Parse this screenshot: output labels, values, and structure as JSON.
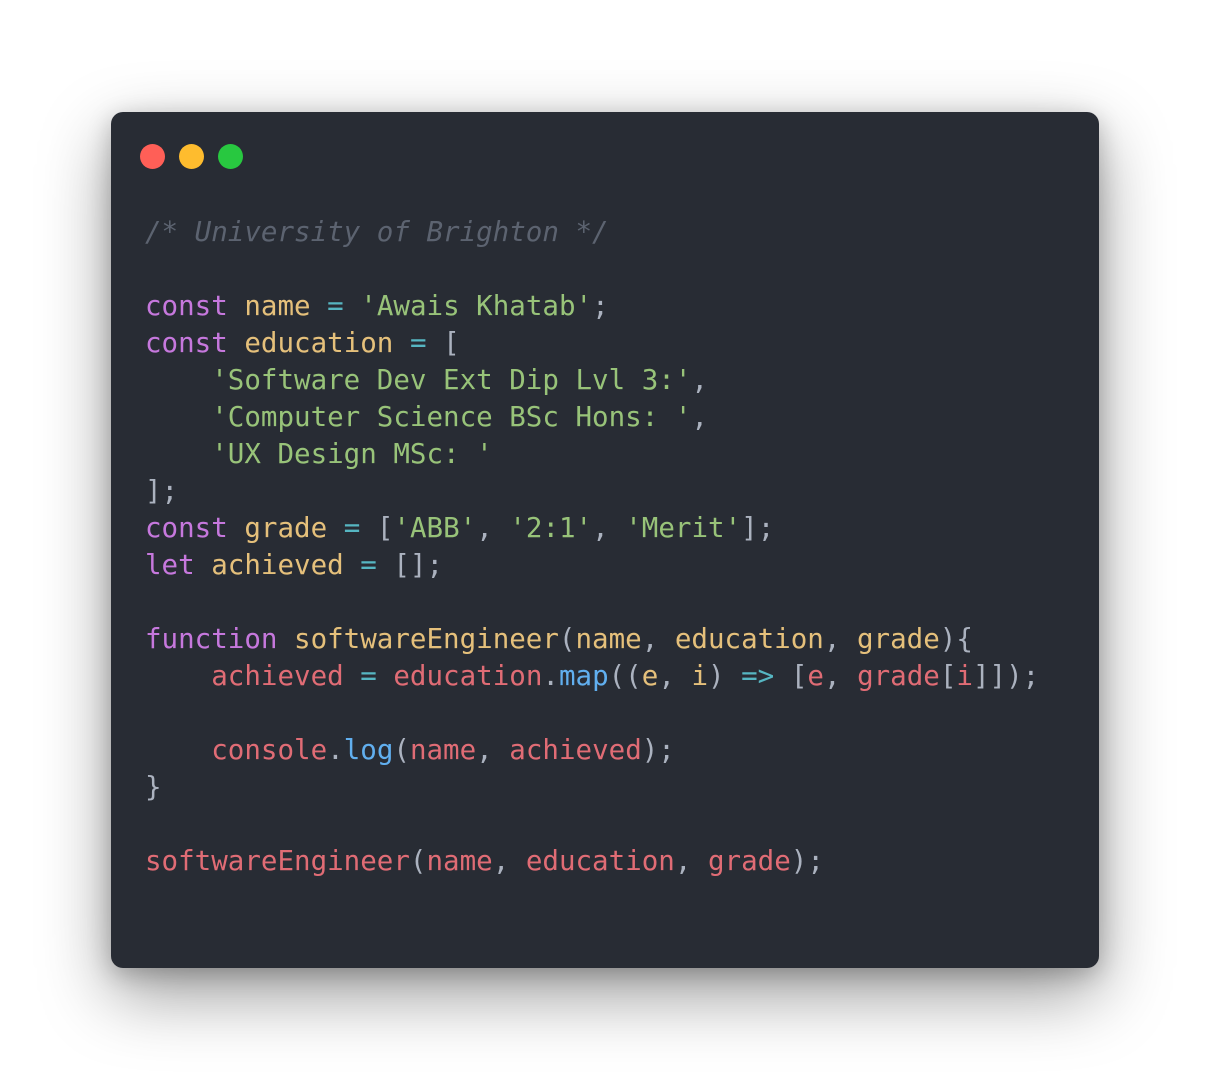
{
  "colors": {
    "background": "#ffffff",
    "window": "#282c34",
    "dot_close": "#ff5f57",
    "dot_minimize": "#febc2e",
    "dot_zoom": "#28c840",
    "comment": "#5c6370",
    "keyword": "#c678dd",
    "variable": "#e5c07b",
    "string": "#98c379",
    "operator": "#56b6c2",
    "punctuation": "#abb2bf",
    "identifier": "#e06c75",
    "method": "#61afef"
  },
  "window": {
    "dots": [
      {
        "name": "close-dot",
        "color": "#ff5f57"
      },
      {
        "name": "minimize-dot",
        "color": "#febc2e"
      },
      {
        "name": "zoom-dot",
        "color": "#28c840"
      }
    ]
  },
  "code_lines": [
    [
      [
        "/* University of Brighton */",
        "comment",
        true
      ]
    ],
    [],
    [
      [
        "const",
        "keyword"
      ],
      [
        " "
      ],
      [
        "name",
        "variable"
      ],
      [
        " "
      ],
      [
        "=",
        "operator"
      ],
      [
        " "
      ],
      [
        "'Awais Khatab'",
        "string"
      ],
      [
        ";",
        "punctuation"
      ]
    ],
    [
      [
        "const",
        "keyword"
      ],
      [
        " "
      ],
      [
        "education",
        "variable"
      ],
      [
        " "
      ],
      [
        "=",
        "operator"
      ],
      [
        " "
      ],
      [
        "[",
        "punctuation"
      ]
    ],
    [
      [
        "    "
      ],
      [
        "'Software Dev Ext Dip Lvl 3:'",
        "string"
      ],
      [
        ",",
        "punctuation"
      ]
    ],
    [
      [
        "    "
      ],
      [
        "'Computer Science BSc Hons: '",
        "string"
      ],
      [
        ",",
        "punctuation"
      ]
    ],
    [
      [
        "    "
      ],
      [
        "'UX Design MSc: '",
        "string"
      ]
    ],
    [
      [
        "];",
        "punctuation"
      ]
    ],
    [
      [
        "const",
        "keyword"
      ],
      [
        " "
      ],
      [
        "grade",
        "variable"
      ],
      [
        " "
      ],
      [
        "=",
        "operator"
      ],
      [
        " "
      ],
      [
        "[",
        "punctuation"
      ],
      [
        "'ABB'",
        "string"
      ],
      [
        ", ",
        "punctuation"
      ],
      [
        "'2:1'",
        "string"
      ],
      [
        ", ",
        "punctuation"
      ],
      [
        "'Merit'",
        "string"
      ],
      [
        "];",
        "punctuation"
      ]
    ],
    [
      [
        "let",
        "keyword"
      ],
      [
        " "
      ],
      [
        "achieved",
        "variable"
      ],
      [
        " "
      ],
      [
        "=",
        "operator"
      ],
      [
        " "
      ],
      [
        "[];",
        "punctuation"
      ]
    ],
    [],
    [
      [
        "function",
        "keyword"
      ],
      [
        " "
      ],
      [
        "softwareEngineer",
        "variable"
      ],
      [
        "(",
        "punctuation"
      ],
      [
        "name",
        "variable"
      ],
      [
        ", ",
        "punctuation"
      ],
      [
        "education",
        "variable"
      ],
      [
        ", ",
        "punctuation"
      ],
      [
        "grade",
        "variable"
      ],
      [
        "){",
        "punctuation"
      ]
    ],
    [
      [
        "    "
      ],
      [
        "achieved",
        "identifier"
      ],
      [
        " "
      ],
      [
        "=",
        "operator"
      ],
      [
        " "
      ],
      [
        "education",
        "identifier"
      ],
      [
        ".",
        "punctuation"
      ],
      [
        "map",
        "method"
      ],
      [
        "((",
        "punctuation"
      ],
      [
        "e",
        "variable"
      ],
      [
        ", ",
        "punctuation"
      ],
      [
        "i",
        "variable"
      ],
      [
        ")",
        "punctuation"
      ],
      [
        " "
      ],
      [
        "=>",
        "operator"
      ],
      [
        " "
      ],
      [
        "[",
        "punctuation"
      ],
      [
        "e",
        "identifier"
      ],
      [
        ", ",
        "punctuation"
      ],
      [
        "grade",
        "identifier"
      ],
      [
        "[",
        "punctuation"
      ],
      [
        "i",
        "identifier"
      ],
      [
        "]]);",
        "punctuation"
      ]
    ],
    [],
    [
      [
        "    "
      ],
      [
        "console",
        "identifier"
      ],
      [
        ".",
        "punctuation"
      ],
      [
        "log",
        "method"
      ],
      [
        "(",
        "punctuation"
      ],
      [
        "name",
        "identifier"
      ],
      [
        ", ",
        "punctuation"
      ],
      [
        "achieved",
        "identifier"
      ],
      [
        ");",
        "punctuation"
      ]
    ],
    [
      [
        "}",
        "punctuation"
      ]
    ],
    [],
    [
      [
        "softwareEngineer",
        "identifier"
      ],
      [
        "(",
        "punctuation"
      ],
      [
        "name",
        "identifier"
      ],
      [
        ", ",
        "punctuation"
      ],
      [
        "education",
        "identifier"
      ],
      [
        ", ",
        "punctuation"
      ],
      [
        "grade",
        "identifier"
      ],
      [
        ");",
        "punctuation"
      ]
    ]
  ]
}
